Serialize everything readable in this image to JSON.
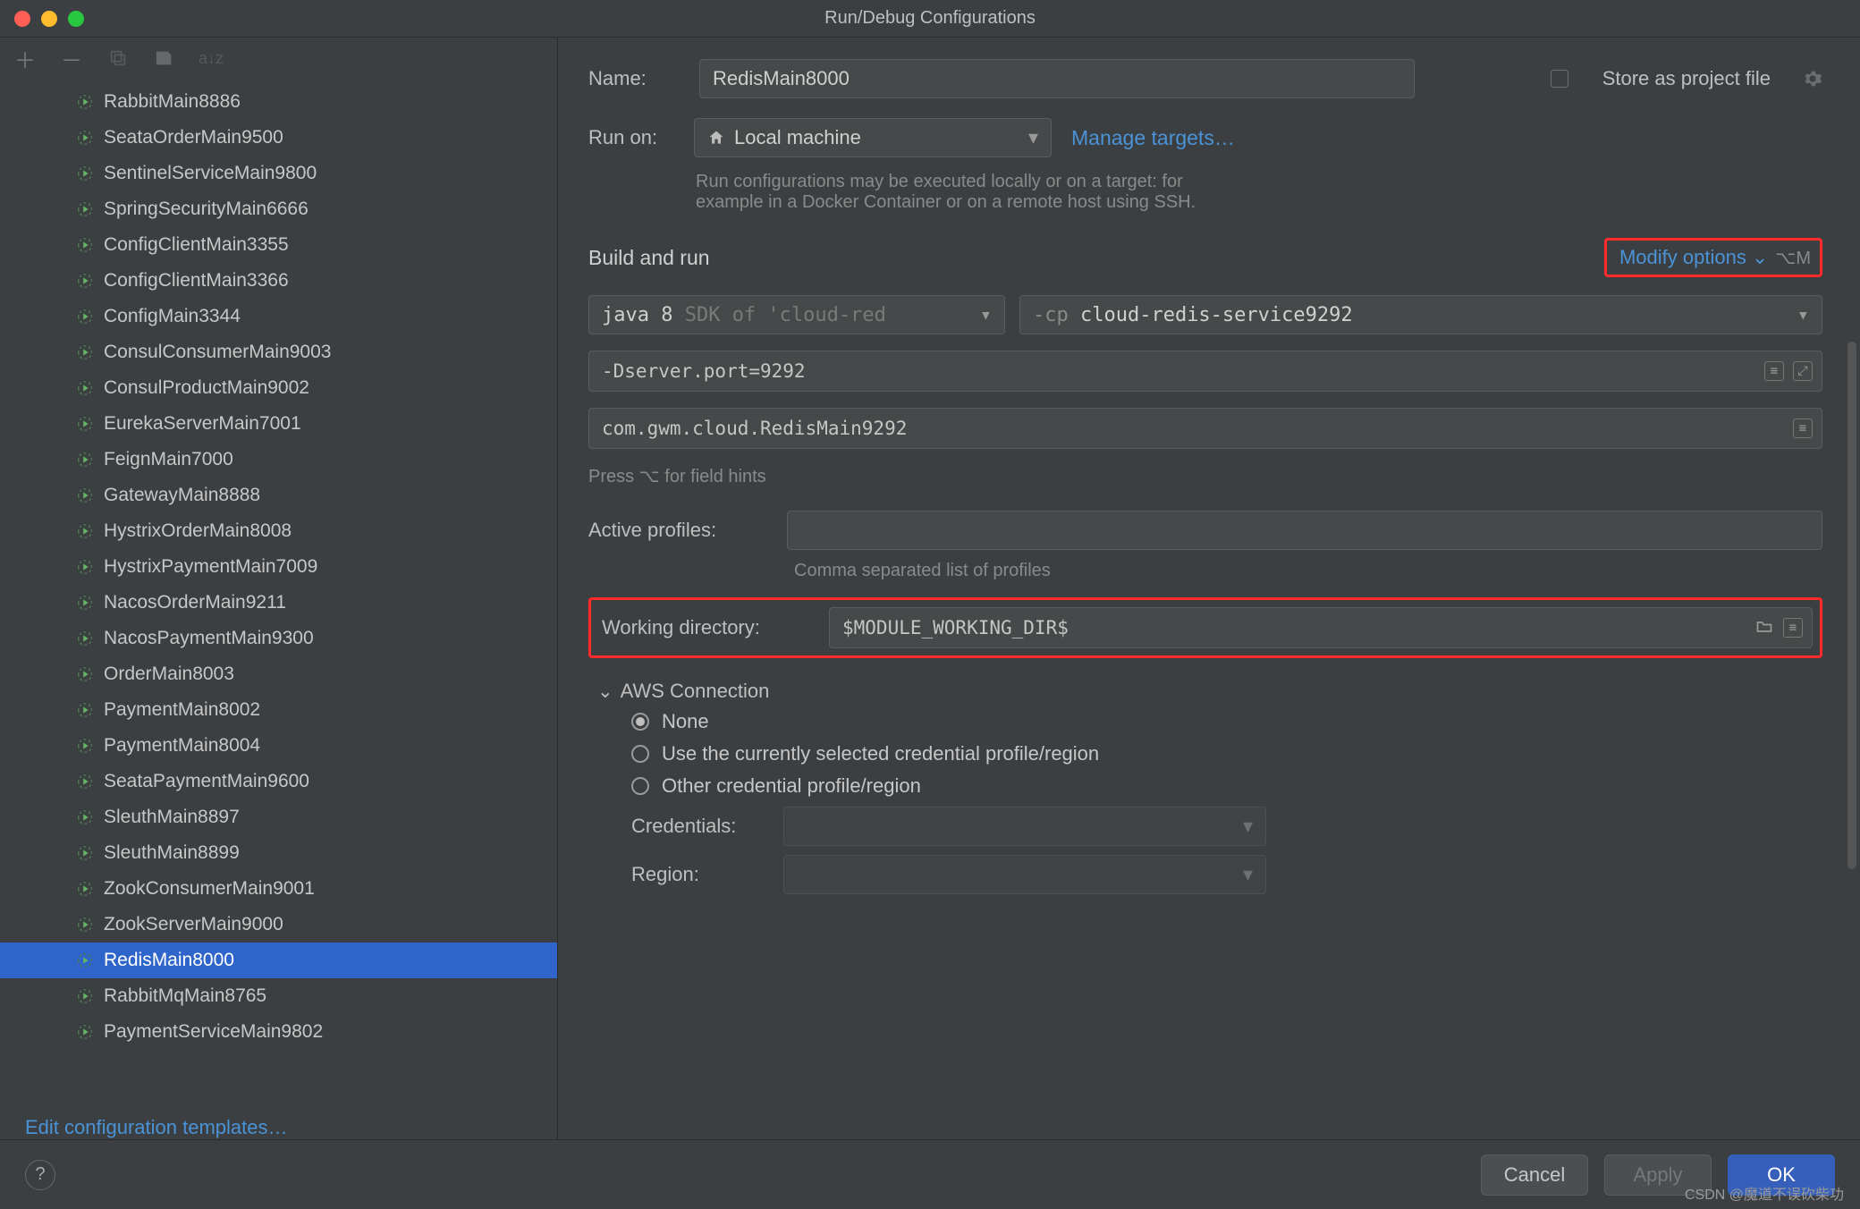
{
  "window": {
    "title": "Run/Debug Configurations"
  },
  "sidebar": {
    "items": [
      {
        "label": "RabbitMain8886"
      },
      {
        "label": "SeataOrderMain9500"
      },
      {
        "label": "SentinelServiceMain9800"
      },
      {
        "label": "SpringSecurityMain6666"
      },
      {
        "label": "ConfigClientMain3355"
      },
      {
        "label": "ConfigClientMain3366"
      },
      {
        "label": "ConfigMain3344"
      },
      {
        "label": "ConsulConsumerMain9003"
      },
      {
        "label": "ConsulProductMain9002"
      },
      {
        "label": "EurekaServerMain7001"
      },
      {
        "label": "FeignMain7000"
      },
      {
        "label": "GatewayMain8888"
      },
      {
        "label": "HystrixOrderMain8008"
      },
      {
        "label": "HystrixPaymentMain7009"
      },
      {
        "label": "NacosOrderMain9211"
      },
      {
        "label": "NacosPaymentMain9300"
      },
      {
        "label": "OrderMain8003"
      },
      {
        "label": "PaymentMain8002"
      },
      {
        "label": "PaymentMain8004"
      },
      {
        "label": "SeataPaymentMain9600"
      },
      {
        "label": "SleuthMain8897"
      },
      {
        "label": "SleuthMain8899"
      },
      {
        "label": "ZookConsumerMain9001"
      },
      {
        "label": "ZookServerMain9000"
      },
      {
        "label": "RedisMain8000",
        "selected": true
      },
      {
        "label": "RabbitMqMain8765"
      },
      {
        "label": "PaymentServiceMain9802"
      }
    ],
    "edit_templates": "Edit configuration templates…"
  },
  "form": {
    "name_label": "Name:",
    "name_value": "RedisMain8000",
    "store_label": "Store as project file",
    "run_on_label": "Run on:",
    "run_on_value": "Local machine",
    "manage_targets": "Manage targets…",
    "run_hint_1": "Run configurations may be executed locally or on a target: for",
    "run_hint_2": "example in a Docker Container or on a remote host using SSH.",
    "build_run": "Build and run",
    "modify_options": "Modify options",
    "modify_shortcut": "⌥M",
    "jdk_prefix": "java 8 ",
    "jdk_hint": "SDK of 'cloud-red",
    "cp_prefix": "-cp ",
    "cp_value": "cloud-redis-service9292",
    "vm_options": "-Dserver.port=9292",
    "main_class": "com.gwm.cloud.RedisMain9292",
    "field_hints": "Press ⌥ for field hints",
    "active_profiles_label": "Active profiles:",
    "active_profiles_hint": "Comma separated list of profiles",
    "working_dir_label": "Working directory:",
    "working_dir_value": "$MODULE_WORKING_DIR$",
    "aws_header": "AWS Connection",
    "aws_none": "None",
    "aws_use_current": "Use the currently selected credential profile/region",
    "aws_other": "Other credential profile/region",
    "aws_credentials": "Credentials:",
    "aws_region": "Region:"
  },
  "footer": {
    "cancel": "Cancel",
    "apply": "Apply",
    "ok": "OK"
  },
  "watermark": "CSDN @魔道不误砍柴功"
}
